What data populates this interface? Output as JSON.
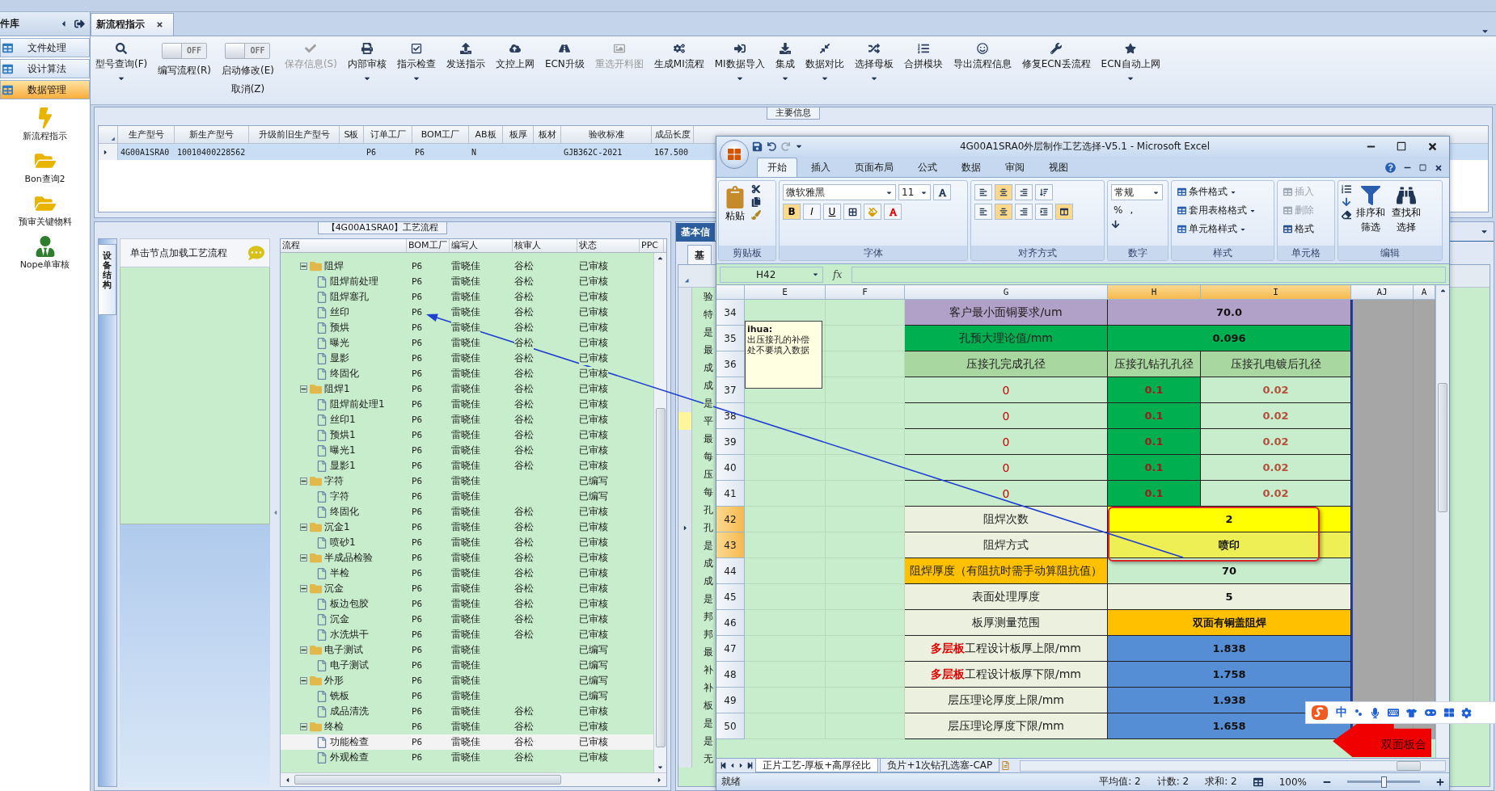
{
  "sidebar": {
    "title": "件库",
    "items": [
      {
        "label": "文件处理",
        "selected": false
      },
      {
        "label": "设计算法",
        "selected": false
      },
      {
        "label": "数据管理",
        "selected": true
      }
    ],
    "shortcuts": [
      {
        "label": "新流程指示"
      },
      {
        "label": "Bon查询2"
      },
      {
        "label": "预审关键物料"
      },
      {
        "label": "Nope单审核"
      }
    ]
  },
  "tabs": [
    {
      "label": "新流程指示",
      "selected": true
    }
  ],
  "toolbar": [
    {
      "kind": "button",
      "label": "型号查询(F)",
      "dropdown": true,
      "disabled": false
    },
    {
      "kind": "toggle",
      "switch": "OFF",
      "on": false,
      "label": "编写流程(R)"
    },
    {
      "kind": "toggle",
      "switch": "OFF",
      "on": false,
      "label": "启动修改(E)",
      "sublabel": "取消(Z)"
    },
    {
      "kind": "button",
      "label": "保存信息(S)",
      "dropdown": false,
      "disabled": true
    },
    {
      "kind": "button",
      "label": "内部审核",
      "dropdown": true,
      "disabled": false
    },
    {
      "kind": "button",
      "label": "指示检查",
      "dropdown": true,
      "disabled": false
    },
    {
      "kind": "button",
      "label": "发送指示",
      "dropdown": false,
      "disabled": false
    },
    {
      "kind": "button",
      "label": "文控上网",
      "dropdown": false,
      "disabled": false
    },
    {
      "kind": "button",
      "label": "ECN升级",
      "dropdown": false,
      "disabled": false
    },
    {
      "kind": "button",
      "label": "重选开料图",
      "dropdown": false,
      "disabled": true
    },
    {
      "kind": "button",
      "label": "生成MI流程",
      "dropdown": false,
      "disabled": false
    },
    {
      "kind": "button",
      "label": "MI数据导入",
      "dropdown": true,
      "disabled": false
    },
    {
      "kind": "button",
      "label": "集成",
      "dropdown": true,
      "disabled": false
    },
    {
      "kind": "button",
      "label": "数据对比",
      "dropdown": true,
      "disabled": false
    },
    {
      "kind": "button",
      "label": "选择母板",
      "dropdown": true,
      "disabled": false
    },
    {
      "kind": "button",
      "label": "合拼模块",
      "dropdown": false,
      "disabled": false
    },
    {
      "kind": "button",
      "label": "导出流程信息",
      "dropdown": false,
      "disabled": false
    },
    {
      "kind": "button",
      "label": "修复ECN丢流程",
      "dropdown": false,
      "disabled": false
    },
    {
      "kind": "button",
      "label": "ECN自动上网",
      "dropdown": true,
      "disabled": false
    }
  ],
  "main_info": {
    "title": "主要信息",
    "columns": [
      "生产型号",
      "新生产型号",
      "升级前旧生产型号",
      "S板",
      "订单工厂",
      "BOM工厂",
      "AB板",
      "板厚",
      "板材",
      "验收标准",
      "成品长度"
    ],
    "rows": [
      {
        "selected": true,
        "cells": [
          "4G00A1SRA0",
          "10010400228562",
          null,
          null,
          "P6",
          "P6",
          "N",
          null,
          null,
          "GJB362C-2021",
          "167.500"
        ]
      }
    ]
  },
  "process": {
    "title": "【4G00A1SRA0】工艺流程",
    "side_tab": "设备结构",
    "hint": "单击节点加载工艺流程",
    "columns": [
      "流程",
      "BOM工厂",
      "编写人",
      "核审人",
      "状态",
      "PPC"
    ],
    "tree": [
      {
        "name": "阻焊",
        "bom": "P6",
        "author": "雷晓佳",
        "reviewer": "谷松",
        "status": "已审核",
        "expanded": true,
        "selected": false,
        "children": [
          {
            "name": "阻焊前处理",
            "bom": "P6",
            "author": "雷晓佳",
            "reviewer": "谷松",
            "status": "已审核",
            "selected": false
          },
          {
            "name": "阻焊塞孔",
            "bom": "P6",
            "author": "雷晓佳",
            "reviewer": "谷松",
            "status": "已审核",
            "selected": false
          },
          {
            "name": "丝印",
            "bom": "P6",
            "author": "雷晓佳",
            "reviewer": "谷松",
            "status": "已审核",
            "selected": false
          },
          {
            "name": "预烘",
            "bom": "P6",
            "author": "雷晓佳",
            "reviewer": "谷松",
            "status": "已审核",
            "selected": false
          },
          {
            "name": "曝光",
            "bom": "P6",
            "author": "雷晓佳",
            "reviewer": "谷松",
            "status": "已审核",
            "selected": false
          },
          {
            "name": "显影",
            "bom": "P6",
            "author": "雷晓佳",
            "reviewer": "谷松",
            "status": "已审核",
            "selected": false
          },
          {
            "name": "终固化",
            "bom": "P6",
            "author": "雷晓佳",
            "reviewer": "谷松",
            "status": "已审核",
            "selected": false
          }
        ]
      },
      {
        "name": "阻焊1",
        "bom": "P6",
        "author": "雷晓佳",
        "reviewer": "谷松",
        "status": "已审核",
        "expanded": true,
        "selected": false,
        "children": [
          {
            "name": "阻焊前处理1",
            "bom": "P6",
            "author": "雷晓佳",
            "reviewer": "谷松",
            "status": "已审核",
            "selected": false
          },
          {
            "name": "丝印1",
            "bom": "P6",
            "author": "雷晓佳",
            "reviewer": "谷松",
            "status": "已审核",
            "selected": false
          },
          {
            "name": "预烘1",
            "bom": "P6",
            "author": "雷晓佳",
            "reviewer": "谷松",
            "status": "已审核",
            "selected": false
          },
          {
            "name": "曝光1",
            "bom": "P6",
            "author": "雷晓佳",
            "reviewer": "谷松",
            "status": "已审核",
            "selected": false
          },
          {
            "name": "显影1",
            "bom": "P6",
            "author": "雷晓佳",
            "reviewer": "谷松",
            "status": "已审核",
            "selected": false
          }
        ]
      },
      {
        "name": "字符",
        "bom": "P6",
        "author": "雷晓佳",
        "status": "已编写",
        "expanded": true,
        "selected": false,
        "children": [
          {
            "name": "字符",
            "bom": "P6",
            "author": "雷晓佳",
            "status": "已编写",
            "selected": false
          },
          {
            "name": "终固化",
            "bom": "P6",
            "author": "雷晓佳",
            "reviewer": "谷松",
            "status": "已审核",
            "selected": false
          }
        ]
      },
      {
        "name": "沉金1",
        "bom": "P6",
        "author": "雷晓佳",
        "reviewer": "谷松",
        "status": "已审核",
        "expanded": true,
        "selected": false,
        "children": [
          {
            "name": "喷砂1",
            "bom": "P6",
            "author": "雷晓佳",
            "reviewer": "谷松",
            "status": "已审核",
            "selected": false
          }
        ]
      },
      {
        "name": "半成品检验",
        "bom": "P6",
        "author": "雷晓佳",
        "reviewer": "谷松",
        "status": "已审核",
        "expanded": true,
        "selected": false,
        "children": [
          {
            "name": "半检",
            "bom": "P6",
            "author": "雷晓佳",
            "reviewer": "谷松",
            "status": "已审核",
            "selected": false
          }
        ]
      },
      {
        "name": "沉金",
        "bom": "P6",
        "author": "雷晓佳",
        "reviewer": "谷松",
        "status": "已审核",
        "expanded": true,
        "selected": false,
        "children": [
          {
            "name": "板边包胶",
            "bom": "P6",
            "author": "雷晓佳",
            "reviewer": "谷松",
            "status": "已审核",
            "selected": false
          },
          {
            "name": "沉金",
            "bom": "P6",
            "author": "雷晓佳",
            "reviewer": "谷松",
            "status": "已审核",
            "selected": false
          },
          {
            "name": "水洗烘干",
            "bom": "P6",
            "author": "雷晓佳",
            "reviewer": "谷松",
            "status": "已审核",
            "selected": false
          }
        ]
      },
      {
        "name": "电子测试",
        "bom": "P6",
        "author": "雷晓佳",
        "status": "已编写",
        "expanded": true,
        "selected": false,
        "children": [
          {
            "name": "电子测试",
            "bom": "P6",
            "author": "雷晓佳",
            "status": "已编写",
            "selected": false
          }
        ]
      },
      {
        "name": "外形",
        "bom": "P6",
        "author": "雷晓佳",
        "status": "已编写",
        "expanded": true,
        "selected": false,
        "children": [
          {
            "name": "铣板",
            "bom": "P6",
            "author": "雷晓佳",
            "status": "已编写",
            "selected": false
          },
          {
            "name": "成品清洗",
            "bom": "P6",
            "author": "雷晓佳",
            "reviewer": "谷松",
            "status": "已审核",
            "selected": false
          }
        ]
      },
      {
        "name": "终检",
        "bom": "P6",
        "author": "雷晓佳",
        "reviewer": "谷松",
        "status": "已审核",
        "expanded": true,
        "selected": false,
        "children": [
          {
            "name": "功能检查",
            "bom": "P6",
            "author": "雷晓佳",
            "reviewer": "谷松",
            "status": "已审核",
            "selected": true
          },
          {
            "name": "外观检查",
            "bom": "P6",
            "author": "雷晓佳",
            "reviewer": "谷松",
            "status": "已审核",
            "selected": false
          }
        ]
      }
    ]
  },
  "basic_info": {
    "tab": "基本信",
    "subtab": "基",
    "rows": [
      {
        "text": "验",
        "highlighted": false,
        "current": false
      },
      {
        "text": "特",
        "highlighted": false,
        "current": false
      },
      {
        "text": "是",
        "highlighted": false,
        "current": false
      },
      {
        "text": "最",
        "highlighted": false,
        "current": false
      },
      {
        "text": "成",
        "highlighted": false,
        "current": false
      },
      {
        "text": "成",
        "highlighted": false,
        "current": false
      },
      {
        "text": "是",
        "highlighted": false,
        "current": false
      },
      {
        "text": "平",
        "highlighted": true,
        "current": false
      },
      {
        "text": "最",
        "highlighted": false,
        "current": false
      },
      {
        "text": "每",
        "highlighted": false,
        "current": false
      },
      {
        "text": "压",
        "highlighted": false,
        "current": false
      },
      {
        "text": "每",
        "highlighted": false,
        "current": false
      },
      {
        "text": "孔",
        "highlighted": false,
        "current": false
      },
      {
        "text": "孔",
        "highlighted": false,
        "current": true
      },
      {
        "text": "是",
        "highlighted": false,
        "current": false
      },
      {
        "text": "成",
        "highlighted": false,
        "current": false
      },
      {
        "text": "成",
        "highlighted": false,
        "current": false
      },
      {
        "text": "是",
        "highlighted": false,
        "current": false
      },
      {
        "text": "邦",
        "highlighted": false,
        "current": false
      },
      {
        "text": "邦",
        "highlighted": false,
        "current": false
      },
      {
        "text": "最",
        "highlighted": false,
        "current": false
      },
      {
        "text": "补",
        "highlighted": false,
        "current": false
      },
      {
        "text": "补",
        "highlighted": false,
        "current": false
      },
      {
        "text": "板",
        "highlighted": false,
        "current": false
      },
      {
        "text": "是",
        "highlighted": false,
        "current": false
      },
      {
        "text": "是",
        "highlighted": false,
        "current": false
      },
      {
        "text": "无",
        "highlighted": false,
        "current": false
      }
    ]
  },
  "excel": {
    "title": "4G00A1SRA0外层制作工艺选择-V5.1 - Microsoft Excel",
    "tabs": [
      {
        "label": "开始",
        "selected": true
      },
      {
        "label": "插入",
        "selected": false
      },
      {
        "label": "页面布局",
        "selected": false
      },
      {
        "label": "公式",
        "selected": false
      },
      {
        "label": "数据",
        "selected": false
      },
      {
        "label": "审阅",
        "selected": false
      },
      {
        "label": "视图",
        "selected": false
      }
    ],
    "ribbon": {
      "paste": "粘贴",
      "clipboard": "剪贴板",
      "font_name": "微软雅黑",
      "font_size": "11",
      "bold": "B",
      "italic": "I",
      "underline": "U",
      "font": "字体",
      "alignment": "对齐方式",
      "number_format": "常规",
      "percent": "%",
      "comma": ",",
      "number": "数字",
      "styles": [
        "条件格式",
        "套用表格格式",
        "单元格样式"
      ],
      "styles_label": "样式",
      "cells": [
        {
          "label": "插入",
          "disabled": true
        },
        {
          "label": "删除",
          "disabled": true
        },
        {
          "label": "格式",
          "disabled": false
        }
      ],
      "cells_label": "单元格",
      "sort": [
        "排序和",
        "筛选"
      ],
      "find": [
        "查找和",
        "选择"
      ],
      "editing": "编辑"
    },
    "name_box": "H42",
    "fx": "fx",
    "columns": [
      {
        "label": "E",
        "selected": false
      },
      {
        "label": "F",
        "selected": false
      },
      {
        "label": "G",
        "selected": false
      },
      {
        "label": "H",
        "selected": true
      },
      {
        "label": "I",
        "selected": true
      },
      {
        "label": "AJ",
        "selected": false
      },
      {
        "label": "A",
        "selected": false
      }
    ],
    "comment": {
      "author": "ihua:",
      "lines": [
        "出压接孔的补偿",
        "处不要填入数据"
      ]
    },
    "rows": [
      {
        "num": "34",
        "selected": false,
        "kind": "title",
        "label": "客户最小面铜要求/um",
        "color": "#b1a0c7",
        "cells": [
          {
            "text": "70.0",
            "color": "#b1a0c7"
          }
        ]
      },
      {
        "num": "35",
        "selected": false,
        "kind": "title",
        "label": "孔预大理论值/mm",
        "color": "#00b050",
        "cells": [
          {
            "text": "0.096",
            "color": "#00b050"
          }
        ]
      },
      {
        "num": "36",
        "selected": false,
        "kind": "plain",
        "label": "压接孔完成孔径",
        "color": "#a9d7a0",
        "cells": [
          {
            "text": "压接孔钻孔孔径",
            "color": "#a9d7a0"
          },
          {
            "text": "压接孔电镀后孔径",
            "color": "#a9d7a0"
          }
        ]
      },
      {
        "num": "37",
        "selected": false,
        "kind": "warning",
        "label": "0",
        "color": "#c7edcc",
        "cells": [
          {
            "text": "0.1",
            "color": "#00b050"
          },
          {
            "text": "0.02",
            "color": "#c7edcc"
          }
        ]
      },
      {
        "num": "38",
        "selected": false,
        "kind": "warning",
        "label": "0",
        "color": "#c7edcc",
        "cells": [
          {
            "text": "0.1",
            "color": "#00b050"
          },
          {
            "text": "0.02",
            "color": "#c7edcc"
          }
        ]
      },
      {
        "num": "39",
        "selected": false,
        "kind": "warning",
        "label": "0",
        "color": "#c7edcc",
        "cells": [
          {
            "text": "0.1",
            "color": "#00b050"
          },
          {
            "text": "0.02",
            "color": "#c7edcc"
          }
        ]
      },
      {
        "num": "40",
        "selected": false,
        "kind": "warning",
        "label": "0",
        "color": "#c7edcc",
        "cells": [
          {
            "text": "0.1",
            "color": "#00b050"
          },
          {
            "text": "0.02",
            "color": "#c7edcc"
          }
        ]
      },
      {
        "num": "41",
        "selected": false,
        "kind": "warning",
        "label": "0",
        "color": "#c7edcc",
        "cells": [
          {
            "text": "0.1",
            "color": "#00b050"
          },
          {
            "text": "0.02",
            "color": "#c7edcc"
          }
        ]
      },
      {
        "num": "42",
        "selected": true,
        "kind": "title",
        "label": "阻焊次数",
        "color": "#ebf1de",
        "cells": [
          {
            "text": "2",
            "color": "#ffff00"
          }
        ]
      },
      {
        "num": "43",
        "selected": true,
        "kind": "title",
        "label": "阻焊方式",
        "color": "#ebf1de",
        "cells": [
          {
            "text": "喷印",
            "color": "#eeee55"
          }
        ]
      },
      {
        "num": "44",
        "selected": false,
        "kind": "title",
        "label": "阻焊厚度（有阻抗时需手动算阻抗值）",
        "color": "#ffc000",
        "cells": [
          {
            "text": "70",
            "color": "#c7edcc"
          }
        ]
      },
      {
        "num": "45",
        "selected": false,
        "kind": "title",
        "label": "表面处理厚度",
        "color": "#ebf1de",
        "cells": [
          {
            "text": "5",
            "color": "#ebf1de"
          }
        ]
      },
      {
        "num": "46",
        "selected": false,
        "kind": "title",
        "label": "板厚测量范围",
        "color": "#ebf1de",
        "cells": [
          {
            "text": "双面有铜盖阻焊",
            "color": "#ffc000"
          }
        ]
      },
      {
        "num": "47",
        "selected": false,
        "kind": "title",
        "label": "**多层板**工程设计板厚上限/mm",
        "color": "#ebf1de",
        "cells": [
          {
            "text": "1.838",
            "color": "#558ed5"
          }
        ]
      },
      {
        "num": "48",
        "selected": false,
        "kind": "title",
        "label": "**多层板**工程设计板厚下限/mm",
        "color": "#ebf1de",
        "cells": [
          {
            "text": "1.758",
            "color": "#558ed5"
          }
        ]
      },
      {
        "num": "49",
        "selected": false,
        "kind": "title",
        "label": "层压理论厚度上限/mm",
        "color": "#ebf1de",
        "cells": [
          {
            "text": "1.938",
            "color": "#558ed5"
          }
        ]
      },
      {
        "num": "50",
        "selected": false,
        "kind": "title",
        "label": "层压理论厚度下限/mm",
        "color": "#ebf1de",
        "cells": [
          {
            "text": "1.658",
            "color": "#558ed5"
          }
        ]
      }
    ],
    "shape_text": "双面板合",
    "sheets": [
      {
        "label": "正片工艺-厚板+高厚径比",
        "selected": true
      },
      {
        "label": "负片+1次钻孔选塞-CAP",
        "selected": false
      }
    ],
    "status": {
      "ready": "就绪",
      "average": "平均值: 2",
      "count": "计数: 2",
      "sum": "求和: 2",
      "zoom": "100%"
    },
    "zoom_slider": {
      "level": 0.5
    }
  },
  "ime": {
    "label": "中"
  }
}
